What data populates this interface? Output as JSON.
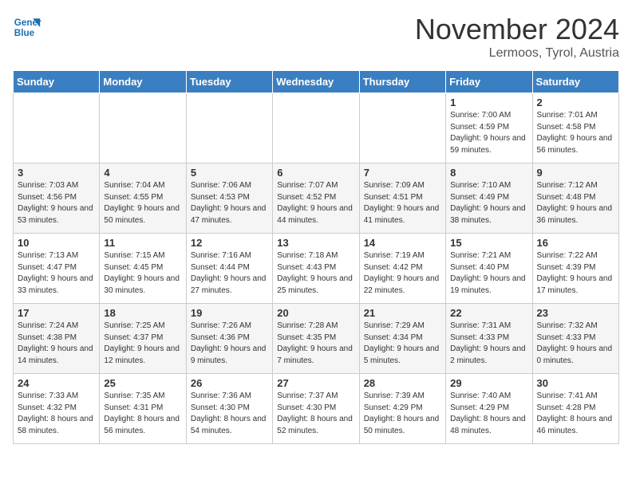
{
  "header": {
    "logo_line1": "General",
    "logo_line2": "Blue",
    "month": "November 2024",
    "location": "Lermoos, Tyrol, Austria"
  },
  "days_of_week": [
    "Sunday",
    "Monday",
    "Tuesday",
    "Wednesday",
    "Thursday",
    "Friday",
    "Saturday"
  ],
  "weeks": [
    [
      {
        "day": "",
        "info": ""
      },
      {
        "day": "",
        "info": ""
      },
      {
        "day": "",
        "info": ""
      },
      {
        "day": "",
        "info": ""
      },
      {
        "day": "",
        "info": ""
      },
      {
        "day": "1",
        "info": "Sunrise: 7:00 AM\nSunset: 4:59 PM\nDaylight: 9 hours\nand 59 minutes."
      },
      {
        "day": "2",
        "info": "Sunrise: 7:01 AM\nSunset: 4:58 PM\nDaylight: 9 hours\nand 56 minutes."
      }
    ],
    [
      {
        "day": "3",
        "info": "Sunrise: 7:03 AM\nSunset: 4:56 PM\nDaylight: 9 hours\nand 53 minutes."
      },
      {
        "day": "4",
        "info": "Sunrise: 7:04 AM\nSunset: 4:55 PM\nDaylight: 9 hours\nand 50 minutes."
      },
      {
        "day": "5",
        "info": "Sunrise: 7:06 AM\nSunset: 4:53 PM\nDaylight: 9 hours\nand 47 minutes."
      },
      {
        "day": "6",
        "info": "Sunrise: 7:07 AM\nSunset: 4:52 PM\nDaylight: 9 hours\nand 44 minutes."
      },
      {
        "day": "7",
        "info": "Sunrise: 7:09 AM\nSunset: 4:51 PM\nDaylight: 9 hours\nand 41 minutes."
      },
      {
        "day": "8",
        "info": "Sunrise: 7:10 AM\nSunset: 4:49 PM\nDaylight: 9 hours\nand 38 minutes."
      },
      {
        "day": "9",
        "info": "Sunrise: 7:12 AM\nSunset: 4:48 PM\nDaylight: 9 hours\nand 36 minutes."
      }
    ],
    [
      {
        "day": "10",
        "info": "Sunrise: 7:13 AM\nSunset: 4:47 PM\nDaylight: 9 hours\nand 33 minutes."
      },
      {
        "day": "11",
        "info": "Sunrise: 7:15 AM\nSunset: 4:45 PM\nDaylight: 9 hours\nand 30 minutes."
      },
      {
        "day": "12",
        "info": "Sunrise: 7:16 AM\nSunset: 4:44 PM\nDaylight: 9 hours\nand 27 minutes."
      },
      {
        "day": "13",
        "info": "Sunrise: 7:18 AM\nSunset: 4:43 PM\nDaylight: 9 hours\nand 25 minutes."
      },
      {
        "day": "14",
        "info": "Sunrise: 7:19 AM\nSunset: 4:42 PM\nDaylight: 9 hours\nand 22 minutes."
      },
      {
        "day": "15",
        "info": "Sunrise: 7:21 AM\nSunset: 4:40 PM\nDaylight: 9 hours\nand 19 minutes."
      },
      {
        "day": "16",
        "info": "Sunrise: 7:22 AM\nSunset: 4:39 PM\nDaylight: 9 hours\nand 17 minutes."
      }
    ],
    [
      {
        "day": "17",
        "info": "Sunrise: 7:24 AM\nSunset: 4:38 PM\nDaylight: 9 hours\nand 14 minutes."
      },
      {
        "day": "18",
        "info": "Sunrise: 7:25 AM\nSunset: 4:37 PM\nDaylight: 9 hours\nand 12 minutes."
      },
      {
        "day": "19",
        "info": "Sunrise: 7:26 AM\nSunset: 4:36 PM\nDaylight: 9 hours\nand 9 minutes."
      },
      {
        "day": "20",
        "info": "Sunrise: 7:28 AM\nSunset: 4:35 PM\nDaylight: 9 hours\nand 7 minutes."
      },
      {
        "day": "21",
        "info": "Sunrise: 7:29 AM\nSunset: 4:34 PM\nDaylight: 9 hours\nand 5 minutes."
      },
      {
        "day": "22",
        "info": "Sunrise: 7:31 AM\nSunset: 4:33 PM\nDaylight: 9 hours\nand 2 minutes."
      },
      {
        "day": "23",
        "info": "Sunrise: 7:32 AM\nSunset: 4:33 PM\nDaylight: 9 hours\nand 0 minutes."
      }
    ],
    [
      {
        "day": "24",
        "info": "Sunrise: 7:33 AM\nSunset: 4:32 PM\nDaylight: 8 hours\nand 58 minutes."
      },
      {
        "day": "25",
        "info": "Sunrise: 7:35 AM\nSunset: 4:31 PM\nDaylight: 8 hours\nand 56 minutes."
      },
      {
        "day": "26",
        "info": "Sunrise: 7:36 AM\nSunset: 4:30 PM\nDaylight: 8 hours\nand 54 minutes."
      },
      {
        "day": "27",
        "info": "Sunrise: 7:37 AM\nSunset: 4:30 PM\nDaylight: 8 hours\nand 52 minutes."
      },
      {
        "day": "28",
        "info": "Sunrise: 7:39 AM\nSunset: 4:29 PM\nDaylight: 8 hours\nand 50 minutes."
      },
      {
        "day": "29",
        "info": "Sunrise: 7:40 AM\nSunset: 4:29 PM\nDaylight: 8 hours\nand 48 minutes."
      },
      {
        "day": "30",
        "info": "Sunrise: 7:41 AM\nSunset: 4:28 PM\nDaylight: 8 hours\nand 46 minutes."
      }
    ]
  ]
}
